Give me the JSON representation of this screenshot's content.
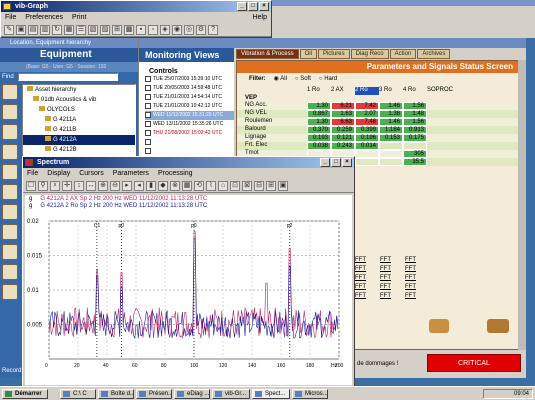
{
  "vibgraph": {
    "title": "vib-Graph",
    "menu": [
      "File",
      "Preferences",
      "Print"
    ],
    "help": "Help"
  },
  "hierarchy": {
    "title": "Location, Equipment hierarchy",
    "heading": "Equipment",
    "find_label": "Find",
    "info": "(Base: G5 - User: G5 - Session: 102",
    "items": [
      "Asset hierarchy",
      "01db Acoustics & vib",
      "OLYCOLS",
      "G 4211A",
      "G 4211B",
      "G 4212A",
      "G 4212B"
    ]
  },
  "monitoring": {
    "title": "Monitoring Views",
    "controls": "Controls",
    "rows": [
      {
        "label": "TUE 25/07/2003 15:39:10 UTC",
        "color": "#000"
      },
      {
        "label": "TUE 20/05/2003 14:59:48 UTC",
        "color": "#000"
      },
      {
        "label": "TUE 21/01/2003 14:54:14 UTC",
        "color": "#000"
      },
      {
        "label": "TUE 21/01/2003 10:42:12 UTC",
        "color": "#000"
      },
      {
        "label": "WED 11/12/2002 15:31:20 UTC",
        "color": "#fff"
      },
      {
        "label": "WED 13/11/2002 15:35:26 UTC",
        "color": "#000"
      },
      {
        "label": "THU 21/08/2002 15:02:42 UTC",
        "color": "#c00000"
      }
    ]
  },
  "params": {
    "tabs": [
      "Vibration & Process",
      "Oil",
      "Pictures",
      "Diag Reco",
      "Action",
      "Archives"
    ],
    "header": "Parameters and Signals Status Screen",
    "filter_label": "Filter:",
    "filters": [
      "All",
      "Soft",
      "Hard"
    ],
    "cols": [
      "1 Ro",
      "2 AX",
      "2 Ro",
      "3 Ro",
      "4 Ro",
      "SOPROC"
    ],
    "group": "VEP",
    "rows": [
      {
        "name": "NG Acc.",
        "vals": [
          "1.30",
          "6.21",
          "7.42",
          "1.46",
          "1.56"
        ],
        "colors": [
          "#4caf50",
          "#e53935",
          "#e53935",
          "#4caf50",
          "#4caf50"
        ]
      },
      {
        "name": "NG VEL",
        "vals": [
          "0.867",
          "1.63",
          "2.07",
          "1.38",
          "1.48"
        ],
        "colors": [
          "#4caf50",
          "#4caf50",
          "#4caf50",
          "#4caf50",
          "#4caf50"
        ]
      },
      {
        "name": "Roulemen",
        "vals": [
          "1.30",
          "6.63",
          "7.48",
          "1.46",
          "1.56"
        ],
        "colors": [
          "#4caf50",
          "#e53935",
          "#e53935",
          "#4caf50",
          "#4caf50"
        ]
      },
      {
        "name": "Balourd",
        "vals": [
          "0.370",
          "0.259",
          "0.399",
          "1.184",
          "0.913"
        ],
        "colors": [
          "#4caf50",
          "#4caf50",
          "#4caf50",
          "#4caf50",
          "#4caf50"
        ]
      },
      {
        "name": "Lignage",
        "vals": [
          "0.193",
          "0.121",
          "0.196",
          "0.153",
          "0.175"
        ],
        "colors": [
          "#4caf50",
          "#4caf50",
          "#4caf50",
          "#4caf50",
          "#4caf50"
        ]
      },
      {
        "name": "Frt. Elec",
        "vals": [
          "0.038",
          "0.243",
          "0.014",
          "",
          ""
        ],
        "colors": [
          "#4caf50",
          "#4caf50",
          "#4caf50",
          "",
          ""
        ]
      },
      {
        "name": "Tmot",
        "vals": [
          "",
          "",
          "",
          "",
          "305"
        ],
        "colors": [
          "",
          "",
          "",
          "",
          "#4caf50"
        ]
      },
      {
        "name": "",
        "vals": [
          "",
          "",
          "",
          "",
          "35.5"
        ],
        "colors": [
          "",
          "",
          "",
          "",
          "#4caf50"
        ]
      }
    ],
    "fft_rows": [
      [
        "FFT",
        "FFT",
        "FFT"
      ],
      [
        "FFT",
        "FFT",
        "FFT"
      ],
      [
        "FFT",
        "FFT",
        "FFT"
      ],
      [
        "FFT",
        "FFT",
        "FFT"
      ],
      [
        "FFT",
        "FFT",
        "FFT"
      ]
    ],
    "damage_text": "de dommages !",
    "critical": "CRITICAL"
  },
  "spectrum": {
    "title": "Spectrum",
    "menu": [
      "File",
      "Display",
      "Cursors",
      "Parameters",
      "Processing"
    ],
    "legend": [
      {
        "unit": "g",
        "text": "G 4212A 2 AX Sp 2 Hz 200 Hz WED 11/12/2002 11:13:28 UTC"
      },
      {
        "unit": "g",
        "text": "G 4212A 2 Ro Sp 2 Hz 200 Hz WED 11/12/2002 11:13:28 UTC"
      }
    ],
    "cursors": [
      "C1",
      "p0",
      "p0",
      "p2"
    ],
    "xunit": "Hz",
    "yunit": "g"
  },
  "chart_data": {
    "type": "line",
    "xlabel": "Hz",
    "ylim": [
      0,
      0.02
    ],
    "xlim": [
      0,
      200
    ],
    "yticks": [
      "0.02",
      "0.015",
      "0.01",
      "0.005"
    ],
    "xticks": [
      "0",
      "20",
      "40",
      "60",
      "80",
      "100",
      "120",
      "140",
      "160",
      "180",
      "200"
    ],
    "series": [
      {
        "name": "G 4212A 2 AX",
        "color": "#c02060",
        "peaks": [
          [
            33,
            0.013
          ],
          [
            50,
            0.0125
          ],
          [
            100,
            0.0185
          ],
          [
            150,
            0.011
          ],
          [
            166,
            0.016
          ]
        ]
      },
      {
        "name": "G 4212A 2 Ro",
        "color": "#1a1aa0",
        "peaks": [
          [
            33,
            0.012
          ],
          [
            50,
            0.0105
          ],
          [
            100,
            0.0175
          ],
          [
            166,
            0.0135
          ]
        ]
      }
    ]
  },
  "taskbar": {
    "start": "Démarrer",
    "time": "09:04",
    "items": [
      "C:\\ C",
      "Boîte d...",
      "Présen...",
      "eDiag ...",
      "vib-Gr...",
      "Spect...",
      "Micros..."
    ]
  },
  "record": "Record"
}
